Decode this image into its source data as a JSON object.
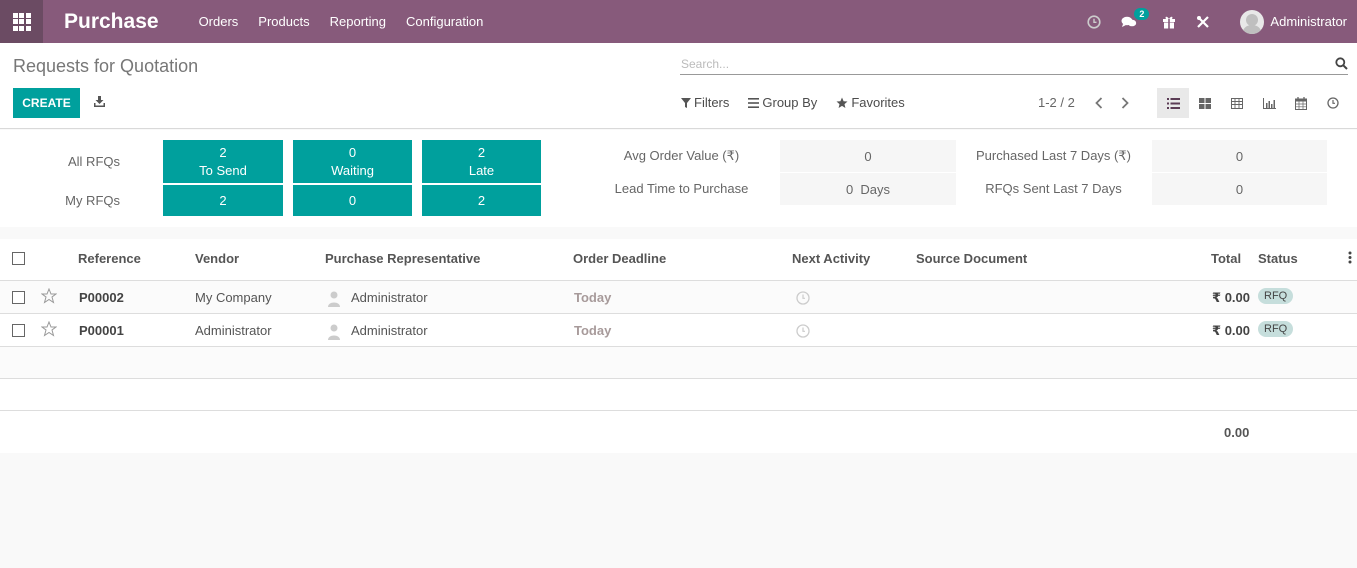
{
  "navbar": {
    "app_name": "Purchase",
    "menu": [
      "Orders",
      "Products",
      "Reporting",
      "Configuration"
    ],
    "messages_badge": "2",
    "user_name": "Administrator",
    "icons": [
      "clock-icon",
      "chat-icon",
      "gift-icon",
      "tools-icon"
    ],
    "brand_color": "#875a7b"
  },
  "control_panel": {
    "title": "Requests for Quotation",
    "create_label": "CREATE",
    "search_placeholder": "Search...",
    "filters_label": "Filters",
    "group_by_label": "Group By",
    "favorites_label": "Favorites",
    "pager": "1-2 / 2",
    "views": [
      "list",
      "kanban",
      "pivot",
      "graph",
      "calendar",
      "activity"
    ],
    "active_view": "list"
  },
  "dashboard": {
    "all_rfqs_label": "All RFQs",
    "my_rfqs_label": "My RFQs",
    "tiles": [
      {
        "all_count": "2",
        "label": "To Send",
        "my_count": "2"
      },
      {
        "all_count": "0",
        "label": "Waiting",
        "my_count": "0"
      },
      {
        "all_count": "2",
        "label": "Late",
        "my_count": "2"
      }
    ],
    "kpis": [
      {
        "label": "Avg Order Value (₹)",
        "value": "0"
      },
      {
        "label": "Lead Time to Purchase",
        "value": "0  Days"
      },
      {
        "label": "Purchased Last 7 Days (₹)",
        "value": "0"
      },
      {
        "label": "RFQs Sent Last 7 Days",
        "value": "0"
      }
    ],
    "accent_color": "#00a09d"
  },
  "table": {
    "columns": [
      "Reference",
      "Vendor",
      "Purchase Representative",
      "Order Deadline",
      "Next Activity",
      "Source Document",
      "Total",
      "Status"
    ],
    "rows": [
      {
        "reference": "P00002",
        "vendor": "My Company",
        "representative": "Administrator",
        "deadline": "Today",
        "source": "",
        "total": "₹ 0.00",
        "status": "RFQ"
      },
      {
        "reference": "P00001",
        "vendor": "Administrator",
        "representative": "Administrator",
        "deadline": "Today",
        "source": "",
        "total": "₹ 0.00",
        "status": "RFQ"
      }
    ],
    "footer_total": "0.00"
  }
}
